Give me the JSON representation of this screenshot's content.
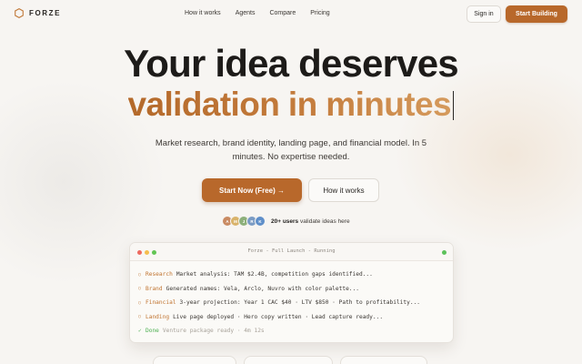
{
  "nav": {
    "brand": "FORZE",
    "links": [
      "How it works",
      "Agents",
      "Compare",
      "Pricing"
    ],
    "sign_in": "Sign in",
    "start_building": "Start Building"
  },
  "hero": {
    "line1": "Your idea deserves",
    "line2": "validation in minutes",
    "subtext": "Market research, brand identity, landing page, and financial model. In 5 minutes. No expertise needed.",
    "cta_primary": "Start Now (Free) →",
    "cta_secondary": "How it works"
  },
  "social_proof": {
    "avatars": [
      {
        "initial": "A",
        "color": "#c98a62"
      },
      {
        "initial": "M",
        "color": "#d9b36a"
      },
      {
        "initial": "J",
        "color": "#8db07a"
      },
      {
        "initial": "R",
        "color": "#7a9bc4"
      },
      {
        "initial": "K",
        "color": "#5f8fc9"
      }
    ],
    "count": "20+ users",
    "text": "validate ideas here"
  },
  "terminal": {
    "title": "Forze - Full Launch - Running",
    "dots": [
      "#ee6a5f",
      "#f5be4f",
      "#62c554"
    ],
    "status_dot": "#5cc15a",
    "lines": [
      {
        "tag": "Research",
        "text": "Market analysis: TAM $2.4B, competition gaps identified..."
      },
      {
        "tag": "Brand",
        "text": "Generated names: Vela, Arclo, Nuvro with color palette..."
      },
      {
        "tag": "Financial",
        "text": "3-year projection: Year 1 CAC $40 · LTV $850 · Path to profitability..."
      },
      {
        "tag": "Landing",
        "text": "Live page deployed · Hero copy written · Lead capture ready..."
      }
    ],
    "done": {
      "icon": "✓",
      "tag": "Done",
      "text": "Venture package ready · 4m 12s"
    }
  },
  "colors": {
    "accent": "#b8682b",
    "background": "#f7f5f2"
  }
}
